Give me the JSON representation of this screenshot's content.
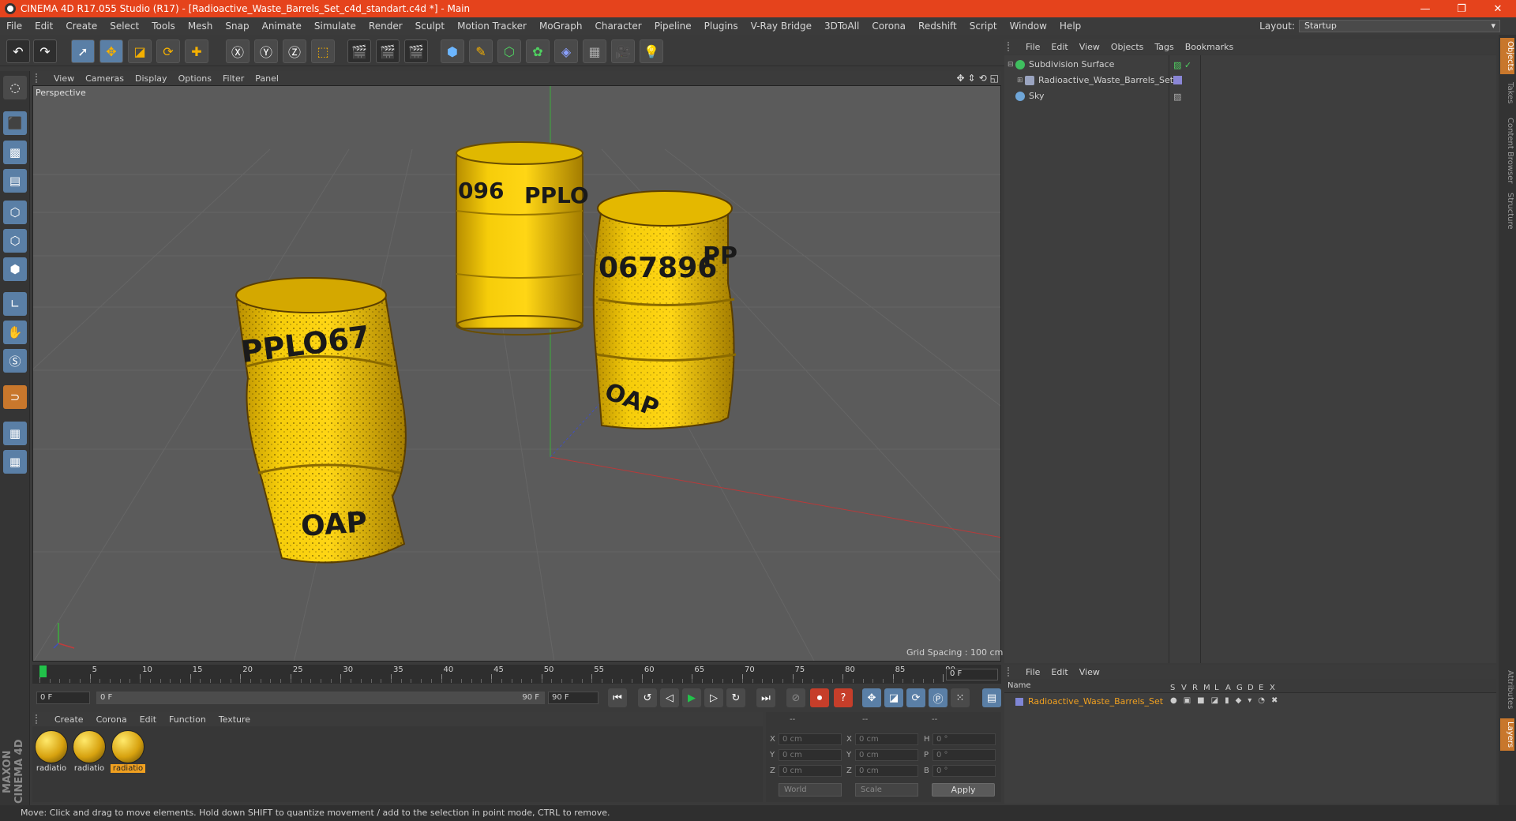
{
  "window": {
    "title": "CINEMA 4D R17.055 Studio (R17) - [Radioactive_Waste_Barrels_Set_c4d_standart.c4d *] - Main",
    "controls": [
      "—",
      "❐",
      "✕"
    ]
  },
  "menu": [
    "File",
    "Edit",
    "Create",
    "Select",
    "Tools",
    "Mesh",
    "Snap",
    "Animate",
    "Simulate",
    "Render",
    "Sculpt",
    "Motion Tracker",
    "MoGraph",
    "Character",
    "Pipeline",
    "Plugins",
    "V-Ray Bridge",
    "3DToAll",
    "Corona",
    "Redshift",
    "Script",
    "Window",
    "Help"
  ],
  "layout": {
    "label": "Layout:",
    "value": "Startup"
  },
  "viewport": {
    "menu": [
      "View",
      "Cameras",
      "Display",
      "Options",
      "Filter",
      "Panel"
    ],
    "label": "Perspective",
    "grid_spacing": "Grid Spacing : 100 cm",
    "barrel_texts": {
      "b1": "PPLO67",
      "b1b": "OAP",
      "b2": "096",
      "b2b": "PPLO",
      "b3": "067896",
      "b3b": "PP",
      "b3c": "OAP"
    }
  },
  "timeline": {
    "ticks": [
      "0",
      "5",
      "10",
      "15",
      "20",
      "25",
      "30",
      "35",
      "40",
      "45",
      "50",
      "55",
      "60",
      "65",
      "70",
      "75",
      "80",
      "85",
      "90"
    ],
    "current_frame": "0 F",
    "start": "0 F",
    "range_start": "0 F",
    "range_end": "90 F",
    "end": "90 F"
  },
  "materials": {
    "menu": [
      "Create",
      "Corona",
      "Edit",
      "Function",
      "Texture"
    ],
    "items": [
      {
        "name": "radiatio",
        "selected": false
      },
      {
        "name": "radiatio",
        "selected": false
      },
      {
        "name": "radiatio",
        "selected": true
      }
    ]
  },
  "coordinates": {
    "headers": [
      "--",
      "--",
      "--"
    ],
    "rows": [
      {
        "a": "X",
        "av": "0 cm",
        "b": "X",
        "bv": "0 cm",
        "c": "H",
        "cv": "0 °"
      },
      {
        "a": "Y",
        "av": "0 cm",
        "b": "Y",
        "bv": "0 cm",
        "c": "P",
        "cv": "0 °"
      },
      {
        "a": "Z",
        "av": "0 cm",
        "b": "Z",
        "bv": "0 cm",
        "c": "B",
        "cv": "0 °"
      }
    ],
    "mode1": "World",
    "mode2": "Scale",
    "apply": "Apply"
  },
  "objects": {
    "menu": [
      "File",
      "Edit",
      "View",
      "Objects",
      "Tags",
      "Bookmarks"
    ],
    "items": [
      {
        "name": "Subdivision Surface",
        "icon_color": "#3fbf5f"
      },
      {
        "name": "Radioactive_Waste_Barrels_Set",
        "icon_color": "#9aa4c0"
      },
      {
        "name": "Sky",
        "icon_color": "#6fa6d8"
      }
    ]
  },
  "layers": {
    "menu": [
      "File",
      "Edit",
      "View"
    ],
    "header": {
      "name": "Name",
      "cols": [
        "S",
        "V",
        "R",
        "M",
        "L",
        "A",
        "G",
        "D",
        "E",
        "X"
      ]
    },
    "items": [
      {
        "name": "Radioactive_Waste_Barrels_Set",
        "color": "#7f86d6"
      }
    ]
  },
  "right_tabs": [
    "Objects",
    "Takes",
    "Content Browser",
    "Structure",
    "Attributes",
    "Layers"
  ],
  "status": "Move: Click and drag to move elements. Hold down SHIFT to quantize movement / add to the selection in point mode, CTRL to remove.",
  "logo": "MAXON CINEMA 4D",
  "colors": {
    "accent": "#e5431c",
    "selection": "#5a7fa6",
    "barrel": "#f2c400"
  }
}
